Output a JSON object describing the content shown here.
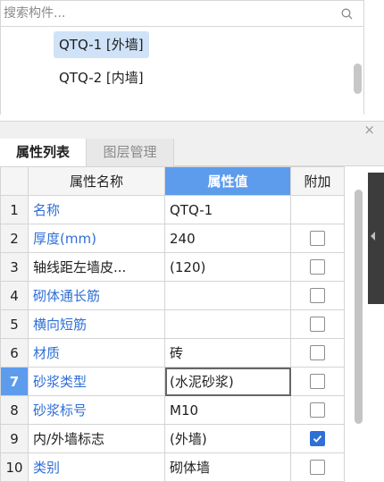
{
  "search": {
    "placeholder": "搜索构件..."
  },
  "components": [
    {
      "label": "QTQ-1 [外墙]",
      "selected": true
    },
    {
      "label": "QTQ-2 [内墙]",
      "selected": false
    }
  ],
  "panel": {
    "close": "×"
  },
  "tabs": [
    {
      "label": "属性列表",
      "active": true
    },
    {
      "label": "图层管理",
      "active": false
    }
  ],
  "table": {
    "headers": {
      "num": "",
      "name": "属性名称",
      "value": "属性值",
      "extra": "附加"
    },
    "rows": [
      {
        "num": "1",
        "name": "名称",
        "blue": true,
        "value": "QTQ-1",
        "checkbox": false,
        "checked": false
      },
      {
        "num": "2",
        "name": "厚度(mm)",
        "blue": true,
        "value": "240",
        "checkbox": true,
        "checked": false
      },
      {
        "num": "3",
        "name": "轴线距左墙皮...",
        "blue": false,
        "value": "(120)",
        "checkbox": true,
        "checked": false
      },
      {
        "num": "4",
        "name": "砌体通长筋",
        "blue": true,
        "value": "",
        "checkbox": true,
        "checked": false
      },
      {
        "num": "5",
        "name": "横向短筋",
        "blue": true,
        "value": "",
        "checkbox": true,
        "checked": false
      },
      {
        "num": "6",
        "name": "材质",
        "blue": true,
        "value": "砖",
        "checkbox": true,
        "checked": false
      },
      {
        "num": "7",
        "name": "砂浆类型",
        "blue": true,
        "value": "(水泥砂浆)",
        "checkbox": true,
        "checked": false,
        "current": true
      },
      {
        "num": "8",
        "name": "砂浆标号",
        "blue": true,
        "value": "M10",
        "checkbox": true,
        "checked": false
      },
      {
        "num": "9",
        "name": "内/外墙标志",
        "blue": false,
        "value": "(外墙)",
        "checkbox": true,
        "checked": true
      },
      {
        "num": "10",
        "name": "类别",
        "blue": true,
        "value": "砌体墙",
        "checkbox": true,
        "checked": false
      }
    ]
  },
  "colors": {
    "accent": "#5d9cec",
    "link_blue": "#2f6fd6",
    "selected_bg": "#cfe2f7"
  }
}
